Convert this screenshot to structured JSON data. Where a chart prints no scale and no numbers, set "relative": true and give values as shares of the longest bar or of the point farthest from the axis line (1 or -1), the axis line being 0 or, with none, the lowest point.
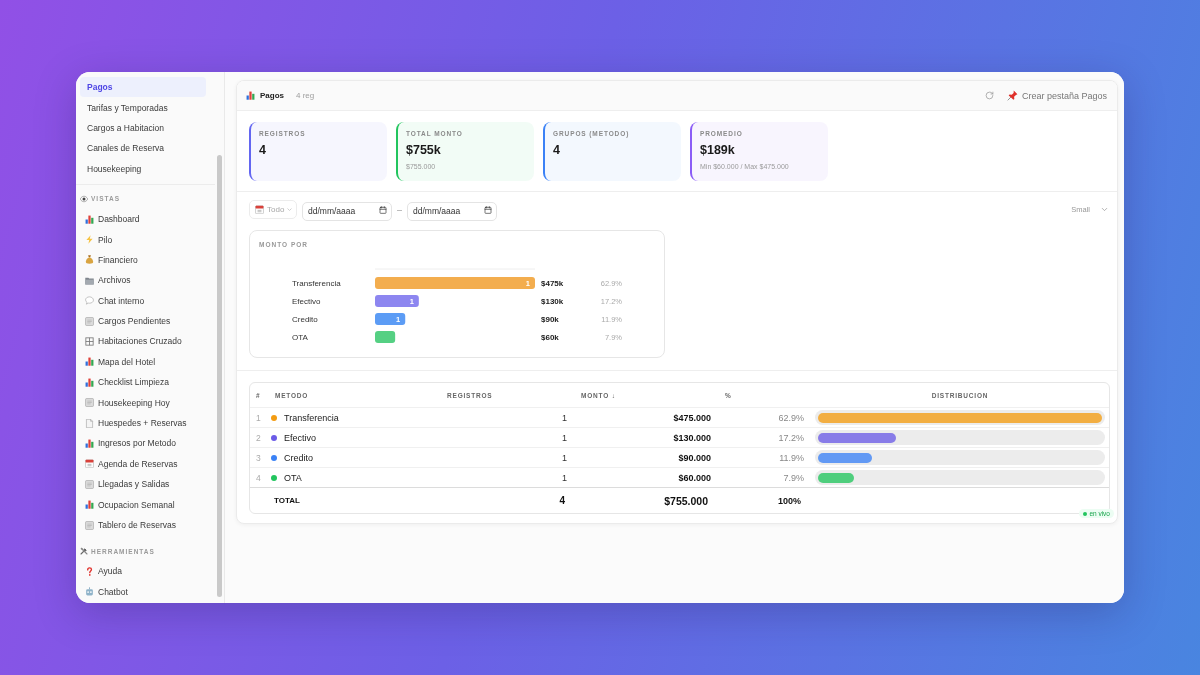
{
  "sidebar": {
    "items": [
      {
        "label": "Pagos",
        "selected": true
      },
      {
        "label": "Tarifas y Temporadas",
        "selected": false
      },
      {
        "label": "Cargos a Habitacion",
        "selected": false
      },
      {
        "label": "Canales de Reserva",
        "selected": false
      },
      {
        "label": "Housekeeping",
        "selected": false
      }
    ],
    "sections": [
      {
        "title": "VISTAS",
        "kind": "eye",
        "items": [
          {
            "label": "Dashboard",
            "kind": "chart",
            "selected": false
          },
          {
            "label": "Pilo",
            "kind": "bolt",
            "selected": false
          },
          {
            "label": "Financiero",
            "kind": "bag",
            "selected": false
          },
          {
            "label": "Archivos",
            "kind": "folder",
            "selected": false
          },
          {
            "label": "Chat interno",
            "kind": "bubble",
            "selected": false
          },
          {
            "label": "Cargos Pendientes",
            "kind": "pad",
            "selected": false
          },
          {
            "label": "Habitaciones Cruzado",
            "kind": "grid",
            "selected": false
          },
          {
            "label": "Mapa del Hotel",
            "kind": "chart",
            "selected": false
          },
          {
            "label": "Checklist Limpieza",
            "kind": "chart",
            "selected": false
          },
          {
            "label": "Housekeeping Hoy",
            "kind": "pad",
            "selected": false
          },
          {
            "label": "Huespedes + Reservas",
            "kind": "page",
            "selected": false
          },
          {
            "label": "Ingresos por Metodo",
            "kind": "chart",
            "selected": false
          },
          {
            "label": "Agenda de Reservas",
            "kind": "calendar",
            "selected": false
          },
          {
            "label": "Llegadas y Salidas",
            "kind": "pad",
            "selected": false
          },
          {
            "label": "Ocupacion Semanal",
            "kind": "chart",
            "selected": false
          },
          {
            "label": "Tablero de Reservas",
            "kind": "pad",
            "selected": false
          }
        ]
      },
      {
        "title": "HERRAMIENTAS",
        "kind": "tools",
        "items": [
          {
            "label": "Ayuda",
            "kind": "question",
            "selected": false
          },
          {
            "label": "Chatbot",
            "kind": "robot",
            "selected": false
          }
        ]
      }
    ]
  },
  "panel": {
    "title": "Pagos",
    "count": "4 reg",
    "pin_button": "Crear pestaña Pagos"
  },
  "kpis": [
    {
      "label": "REGISTROS",
      "value": "4",
      "color": "#6366f1"
    },
    {
      "label": "TOTAL MONTO",
      "value": "$755k",
      "sub": "$755.000",
      "color": "#22c55e"
    },
    {
      "label": "GRUPOS (METODO)",
      "value": "4",
      "color": "#3b82f6"
    },
    {
      "label": "PROMEDIO",
      "value": "$189k",
      "sub": "Min $60.000 / Max $475.000",
      "color": "#8b5cf6"
    }
  ],
  "filters": {
    "range": "Todo",
    "date_from": {
      "placeholder": "dd/mm/aaaa"
    },
    "separator": "–",
    "date_to": {
      "placeholder": "dd/mm/aaaa"
    },
    "size": "Small"
  },
  "chart": {
    "chart_data": {
      "type": "bar",
      "title": "MONTO POR",
      "orientation": "horizontal",
      "relative": true,
      "categories": [
        "Transferencia",
        "Efectivo",
        "Credito",
        "OTA"
      ],
      "values": [
        1,
        0.274,
        0.189,
        0.126
      ]
    },
    "bars": [
      {
        "count": "1",
        "amount": "$475k",
        "share": "62.9%",
        "color": "#f3ad4e"
      },
      {
        "count": "1",
        "amount": "$130k",
        "share": "17.2%",
        "color": "#8d86f0"
      },
      {
        "count": "1",
        "amount": "$90k",
        "share": "11.9%",
        "color": "#5c9cf5"
      },
      {
        "amount": "$60k",
        "share": "7.9%",
        "color": "#55d083"
      }
    ]
  },
  "table": {
    "columns": [
      "#",
      "METODO",
      "REGISTROS",
      "MONTO ↓",
      "%",
      "DISTRIBUCION"
    ],
    "rows": [
      {
        "index": "1",
        "method": "Transferencia",
        "color": "#f39c12",
        "count": "1",
        "amount": "$475.000",
        "share": "62.9%",
        "level": 1
      },
      {
        "index": "2",
        "method": "Efectivo",
        "color": "#6b5ce7",
        "count": "1",
        "amount": "$130.000",
        "share": "17.2%",
        "level": 0.274
      },
      {
        "index": "3",
        "method": "Credito",
        "color": "#3b82f6",
        "count": "1",
        "amount": "$90.000",
        "share": "11.9%",
        "level": 0.189
      },
      {
        "index": "4",
        "method": "OTA",
        "color": "#22c55e",
        "count": "1",
        "amount": "$60.000",
        "share": "7.9%",
        "level": 0.126
      }
    ],
    "total": {
      "label": "TOTAL",
      "count": "4",
      "amount": "$755.000",
      "share": "100%"
    }
  },
  "live_badge": "en vivo"
}
